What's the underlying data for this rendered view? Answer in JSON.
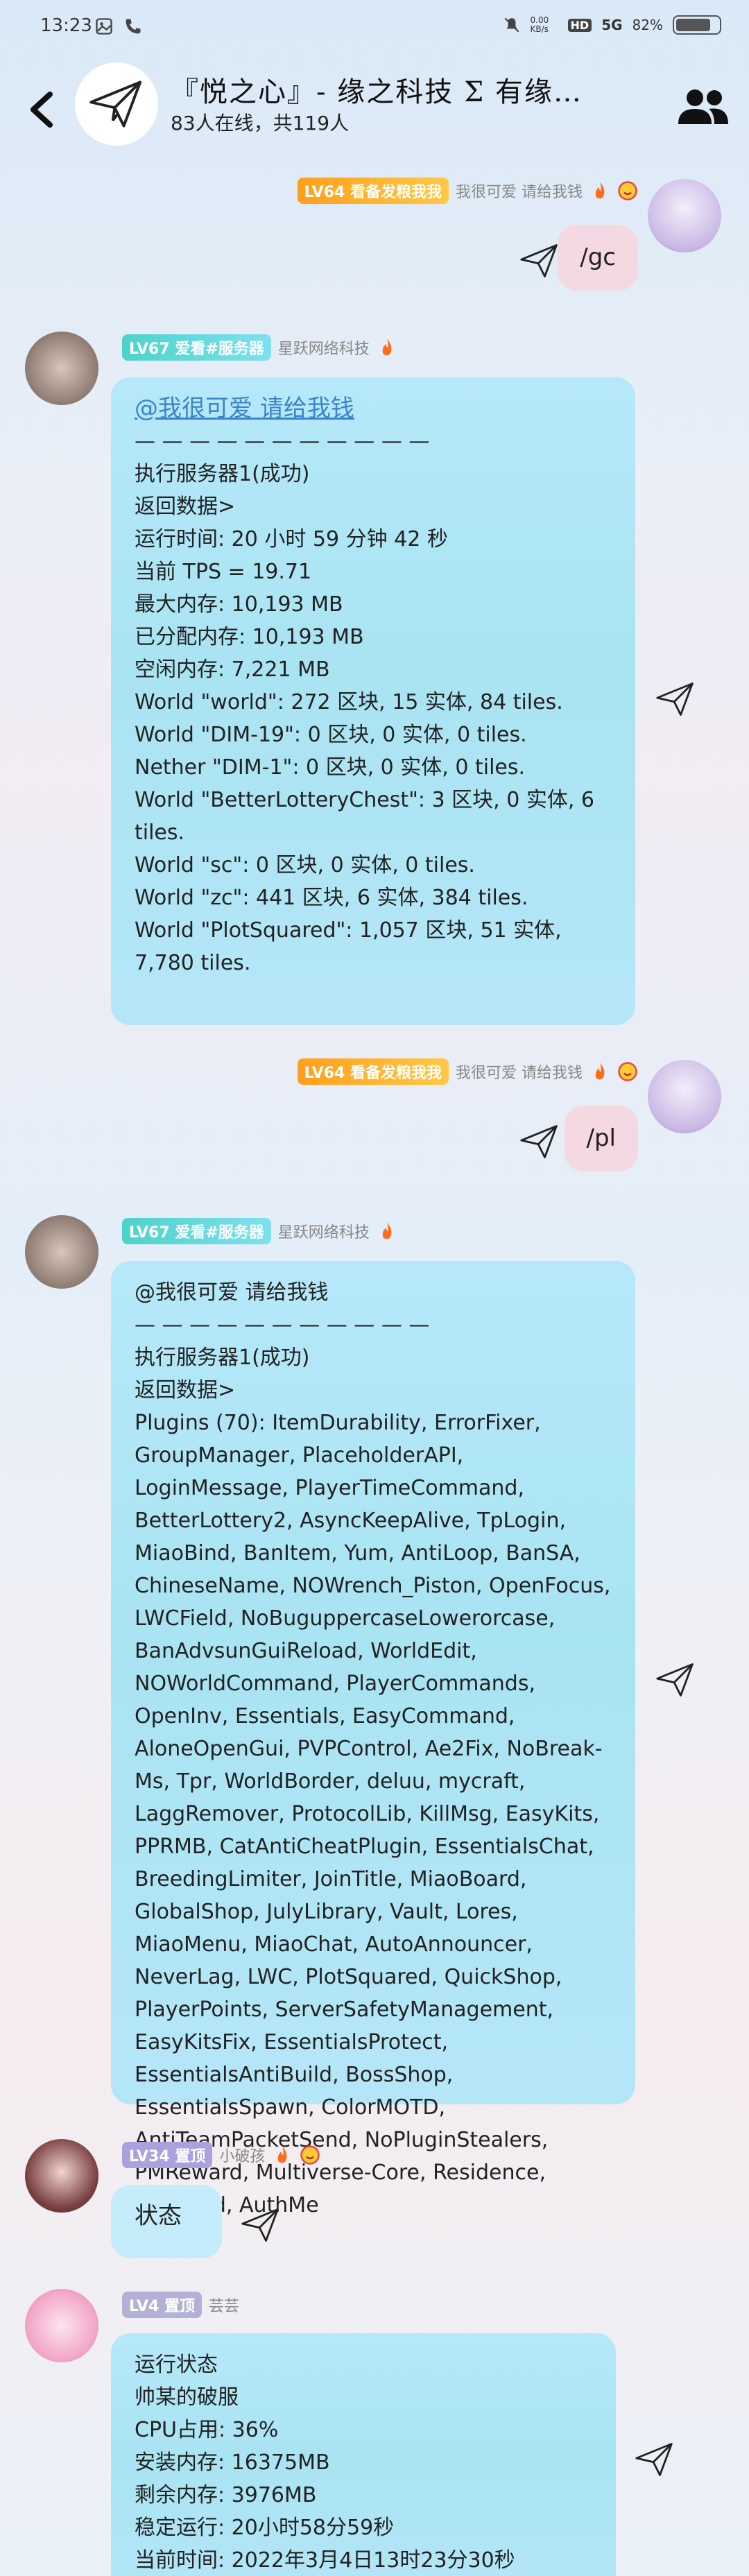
{
  "status": {
    "time": "13:23",
    "speed": "0.00 KB/s",
    "network": "5G",
    "battery": "82%",
    "battery_level": 0.82
  },
  "header": {
    "title": "『悦之心』- 缘之科技 Σ 有缘…",
    "subtitle": "83人在线，共119人"
  },
  "messages": [
    {
      "id": "m1",
      "side": "right",
      "level": "LV64",
      "title": "看备发粮我我",
      "name": "我很可爱 请给我钱",
      "text": "/gc"
    },
    {
      "id": "m2",
      "side": "left",
      "level": "LV67",
      "title": "爱看#服务器",
      "name": "星跃网络科技",
      "mention": "@我很可爱 请给我钱",
      "lines": [
        "— — — — — — — — — — —",
        "执行服务器1(成功)",
        "返回数据>",
        "运行时间: 20 小时 59 分钟 42 秒",
        "当前 TPS = 19.71",
        "最大内存: 10,193 MB",
        "已分配内存: 10,193 MB",
        "空闲内存: 7,221 MB",
        "World \"world\": 272 区块, 15 实体, 84 tiles.",
        "World \"DIM-19\": 0 区块, 0 实体, 0 tiles.",
        "Nether \"DIM-1\": 0 区块, 0 实体, 0 tiles.",
        "World \"BetterLotteryChest\": 3 区块, 0 实体, 6 tiles.",
        "World \"sc\": 0 区块, 0 实体, 0 tiles.",
        "World \"zc\": 441 区块, 6 实体, 384 tiles.",
        "World \"PlotSquared\": 1,057 区块, 51 实体, 7,780 tiles."
      ]
    },
    {
      "id": "m3",
      "side": "right",
      "level": "LV64",
      "title": "看备发粮我我",
      "name": "我很可爱 请给我钱",
      "text": "/pl"
    },
    {
      "id": "m4",
      "side": "left",
      "level": "LV67",
      "title": "爱看#服务器",
      "name": "星跃网络科技",
      "lines": [
        "@我很可爱 请给我钱",
        "— — — — — — — — — — —",
        "执行服务器1(成功)",
        "返回数据>",
        "Plugins (70): ItemDurability, ErrorFixer, GroupManager, PlaceholderAPI, LoginMessage, PlayerTimeCommand, BetterLottery2, AsyncKeepAlive, TpLogin, MiaoBind, BanItem, Yum, AntiLoop, BanSA, ChineseName, NOWrench_Piston, OpenFocus, LWCField, NoBuguppercaseLowerorcase, BanAdvsunGuiReload, WorldEdit, NOWorldCommand, PlayerCommands, OpenInv, Essentials, EasyCommand, AloneOpenGui, PVPControl, Ae2Fix, NoBreak-Ms, Tpr, WorldBorder, deluu, mycraft, LaggRemover, ProtocolLib, KillMsg, EasyKits, PPRMB, CatAntiCheatPlugin, EssentialsChat, BreedingLimiter, JoinTitle, MiaoBoard, GlobalShop, JulyLibrary, Vault, Lores, MiaoMenu, MiaoChat, AutoAnnouncer, NeverLag, LWC, PlotSquared, QuickShop, PlayerPoints, ServerSafetyManagement, EasyKitsFix, EssentialsProtect, EssentialsAntiBuild, BossShop, EssentialsSpawn, ColorMOTD, AntiTeamPacketSend, NoPluginStealers, PMReward, Multiverse-Core, Residence, JulyGuild, AuthMe"
      ]
    },
    {
      "id": "m5",
      "side": "left",
      "level": "LV34",
      "title": "置顶",
      "name": "小破孩",
      "text": "状态"
    },
    {
      "id": "m6",
      "side": "left",
      "level": "LV4",
      "title": "置顶",
      "name": "芸芸",
      "lines": [
        "运行状态",
        "帅某的破服",
        "CPU占用: 36%",
        "安装内存: 16375MB",
        "剩余内存: 3976MB",
        "稳定运行: 20小时58分59秒",
        "当前时间: 2022年3月4日13时23分30秒"
      ]
    }
  ],
  "colors": {
    "accent_orange": "#ff9f1c",
    "accent_cyan": "#4dd3c9",
    "bubble_blue": "#b6e8f9",
    "bubble_pink": "#f4d9e3",
    "link": "#3c84c9"
  },
  "icons": {
    "back": "chevron-left-icon",
    "group": "paper-plane-icon",
    "members": "people-icon",
    "send": "paper-plane-outline-icon"
  }
}
